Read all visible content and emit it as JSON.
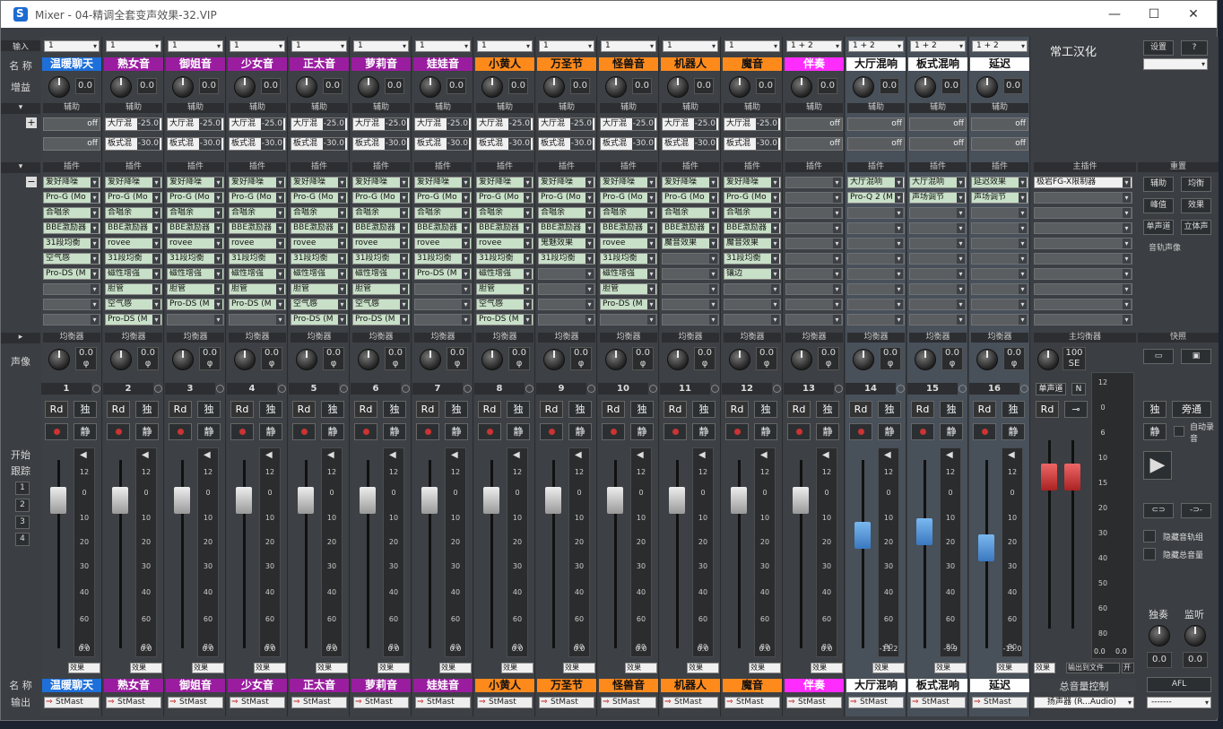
{
  "window": {
    "title": "Mixer - 04-精调全套变声效果-32.VIP",
    "min": "—",
    "max": "☐",
    "close": "✕"
  },
  "row_labels": {
    "input": "输入",
    "name": "名 称",
    "gain": "增益",
    "aux": "辅助",
    "plugin": "插件",
    "eq": "均衡器",
    "pan": "声像",
    "start": "开始",
    "follow": "跟踪",
    "name2": "名 称",
    "output": "输出",
    "groups": [
      "1",
      "2",
      "3",
      "4"
    ]
  },
  "channels": [
    {
      "num": "1",
      "input": "1",
      "name": "温暖聊天",
      "name_bg": "#1e6fd9",
      "name_fg": "#ffffff",
      "gain": "0.0",
      "aux1": "off",
      "aux2": "off",
      "aux_on": false,
      "plugins": [
        "爱好降噪",
        "Pro-G (Mo",
        "合唱余",
        "BBE激励器",
        "31段均衡",
        "空气感",
        "Pro-DS (M",
        "",
        "",
        ""
      ],
      "pan": "0.0",
      "level": "0.0",
      "bus": false
    },
    {
      "num": "2",
      "input": "1",
      "name": "熟女音",
      "name_bg": "#9a1da0",
      "name_fg": "#ffffff",
      "gain": "0.0",
      "aux1": "-25.0",
      "aux2": "-30.0",
      "aux_on": true,
      "plugins": [
        "爱好降噪",
        "Pro-G (Mo",
        "合唱余",
        "BBE激励器",
        "rovee",
        "31段均衡",
        "磁性增强",
        "胆管",
        "空气感",
        "Pro-DS (M"
      ],
      "pan": "0.0",
      "level": "0.0",
      "bus": false
    },
    {
      "num": "3",
      "input": "1",
      "name": "御姐音",
      "name_bg": "#9a1da0",
      "name_fg": "#ffffff",
      "gain": "0.0",
      "aux1": "-25.0",
      "aux2": "-30.0",
      "aux_on": true,
      "plugins": [
        "爱好降噪",
        "Pro-G (Mo",
        "合唱余",
        "BBE激励器",
        "rovee",
        "31段均衡",
        "磁性增强",
        "胆管",
        "Pro-DS (M",
        ""
      ],
      "pan": "0.0",
      "level": "0.0",
      "bus": false
    },
    {
      "num": "4",
      "input": "1",
      "name": "少女音",
      "name_bg": "#9a1da0",
      "name_fg": "#ffffff",
      "gain": "0.0",
      "aux1": "-25.0",
      "aux2": "-30.0",
      "aux_on": true,
      "plugins": [
        "爱好降噪",
        "Pro-G (Mo",
        "合唱余",
        "BBE激励器",
        "rovee",
        "31段均衡",
        "磁性增强",
        "胆管",
        "Pro-DS (M",
        ""
      ],
      "pan": "0.0",
      "level": "0.0",
      "bus": false
    },
    {
      "num": "5",
      "input": "1",
      "name": "正太音",
      "name_bg": "#9a1da0",
      "name_fg": "#ffffff",
      "gain": "0.0",
      "aux1": "-25.0",
      "aux2": "-30.0",
      "aux_on": true,
      "plugins": [
        "爱好降噪",
        "Pro-G (Mo",
        "合唱余",
        "BBE激励器",
        "rovee",
        "31段均衡",
        "磁性增强",
        "胆管",
        "空气感",
        "Pro-DS (M"
      ],
      "pan": "0.0",
      "level": "0.0",
      "bus": false
    },
    {
      "num": "6",
      "input": "1",
      "name": "萝莉音",
      "name_bg": "#9a1da0",
      "name_fg": "#ffffff",
      "gain": "0.0",
      "aux1": "-25.0",
      "aux2": "-30.0",
      "aux_on": true,
      "plugins": [
        "爱好降噪",
        "Pro-G (Mo",
        "合唱余",
        "BBE激励器",
        "rovee",
        "31段均衡",
        "磁性增强",
        "胆管",
        "空气感",
        "Pro-DS (M"
      ],
      "pan": "0.0",
      "level": "0.0",
      "bus": false
    },
    {
      "num": "7",
      "input": "1",
      "name": "娃娃音",
      "name_bg": "#9a1da0",
      "name_fg": "#ffffff",
      "gain": "0.0",
      "aux1": "-25.0",
      "aux2": "-30.0",
      "aux_on": true,
      "plugins": [
        "爱好降噪",
        "Pro-G (Mo",
        "合唱余",
        "BBE激励器",
        "rovee",
        "31段均衡",
        "Pro-DS (M",
        "",
        "",
        ""
      ],
      "pan": "0.0",
      "level": "0.0",
      "bus": false
    },
    {
      "num": "8",
      "input": "1",
      "name": "小黄人",
      "name_bg": "#ff8a1c",
      "name_fg": "#111111",
      "gain": "0.0",
      "aux1": "-25.0",
      "aux2": "-30.0",
      "aux_on": true,
      "plugins": [
        "爱好降噪",
        "Pro-G (Mo",
        "合唱余",
        "BBE激励器",
        "rovee",
        "31段均衡",
        "磁性增强",
        "胆管",
        "空气感",
        "Pro-DS (M"
      ],
      "pan": "0.0",
      "level": "0.0",
      "bus": false
    },
    {
      "num": "9",
      "input": "1",
      "name": "万圣节",
      "name_bg": "#ff8a1c",
      "name_fg": "#111111",
      "gain": "0.0",
      "aux1": "-25.0",
      "aux2": "-30.0",
      "aux_on": true,
      "plugins": [
        "爱好降噪",
        "Pro-G (Mo",
        "合唱余",
        "BBE激励器",
        "鬼魅效果",
        "31段均衡",
        "",
        "",
        "",
        ""
      ],
      "pan": "0.0",
      "level": "0.0",
      "bus": false
    },
    {
      "num": "10",
      "input": "1",
      "name": "怪兽音",
      "name_bg": "#ff8a1c",
      "name_fg": "#111111",
      "gain": "0.0",
      "aux1": "-25.0",
      "aux2": "-30.0",
      "aux_on": true,
      "plugins": [
        "爱好降噪",
        "Pro-G (Mo",
        "合唱余",
        "BBE激励器",
        "rovee",
        "31段均衡",
        "磁性增强",
        "胆管",
        "Pro-DS (M",
        ""
      ],
      "pan": "0.0",
      "level": "0.0",
      "bus": false
    },
    {
      "num": "11",
      "input": "1",
      "name": "机器人",
      "name_bg": "#ff8a1c",
      "name_fg": "#111111",
      "gain": "0.0",
      "aux1": "-25.0",
      "aux2": "-30.0",
      "aux_on": true,
      "plugins": [
        "爱好降噪",
        "Pro-G (Mo",
        "合唱余",
        "BBE激励器",
        "魔音效果",
        "",
        "",
        "",
        "",
        ""
      ],
      "pan": "0.0",
      "level": "0.0",
      "bus": false
    },
    {
      "num": "12",
      "input": "1",
      "name": "魔音",
      "name_bg": "#ff8a1c",
      "name_fg": "#111111",
      "gain": "0.0",
      "aux1": "-25.0",
      "aux2": "-30.0",
      "aux_on": true,
      "plugins": [
        "爱好降噪",
        "Pro-G (Mo",
        "合唱余",
        "BBE激励器",
        "魔音效果",
        "31段均衡",
        "镶边",
        "",
        "",
        ""
      ],
      "pan": "0.0",
      "level": "0.0",
      "bus": false
    },
    {
      "num": "13",
      "input": "1 + 2",
      "name": "伴奏",
      "name_bg": "#ff2cff",
      "name_fg": "#ffffff",
      "gain": "0.0",
      "aux1": "off",
      "aux2": "off",
      "aux_on": false,
      "plugins": [
        "",
        "",
        "",
        "",
        "",
        "",
        "",
        "",
        "",
        ""
      ],
      "pan": "0.0",
      "level": "0.0",
      "bus": false
    },
    {
      "num": "14",
      "input": "1 + 2",
      "name": "大厅混响",
      "name_bg": "#ffffff",
      "name_fg": "#111111",
      "gain": "0.0",
      "aux1": "off",
      "aux2": "off",
      "aux_on": false,
      "plugins": [
        "大厅混响",
        "Pro-Q 2 (M",
        "",
        "",
        "",
        "",
        "",
        "",
        "",
        ""
      ],
      "pan": "0.0",
      "level": "-11.2",
      "bus": true
    },
    {
      "num": "15",
      "input": "1 + 2",
      "name": "板式混响",
      "name_bg": "#ffffff",
      "name_fg": "#111111",
      "gain": "0.0",
      "aux1": "off",
      "aux2": "off",
      "aux_on": false,
      "plugins": [
        "大厅混响",
        "声场调节",
        "",
        "",
        "",
        "",
        "",
        "",
        "",
        ""
      ],
      "pan": "0.0",
      "level": "-9.9",
      "bus": true
    },
    {
      "num": "16",
      "input": "1 + 2",
      "name": "延迟",
      "name_bg": "#ffffff",
      "name_fg": "#111111",
      "gain": "0.0",
      "aux1": "off",
      "aux2": "off",
      "aux_on": false,
      "plugins": [
        "延迟效果",
        "声场调节",
        "",
        "",
        "",
        "",
        "",
        "",
        "",
        ""
      ],
      "pan": "0.0",
      "level": "-15.0",
      "bus": true
    }
  ],
  "channel_labels": {
    "aux_hdr": "辅助",
    "plugin_hdr": "插件",
    "eq_hdr": "均衡器",
    "rd": "Rd",
    "solo": "独",
    "mute": "静",
    "fx": "效果",
    "output": "StMast",
    "aux1_name": "大厅混",
    "aux2_name": "板式混"
  },
  "meter_scale": [
    "12",
    "0",
    "10",
    "20",
    "30",
    "40",
    "60",
    "80"
  ],
  "master": {
    "brand": "常工汉化",
    "plugin_hdr": "主插件",
    "plugin1": "极岩FG-X限制器",
    "eq_hdr": "主均衡器",
    "pan": "100",
    "pan_unit": "SE",
    "mono": "单声道",
    "n": "N",
    "fx": "效果",
    "export": "输出到文件",
    "open": "开",
    "name": "总音量控制",
    "output": "扬声器 (R...Audio)",
    "scale": [
      "12",
      "0",
      "6",
      "10",
      "15",
      "20",
      "30",
      "40",
      "50",
      "60",
      "80"
    ],
    "val_l": "0.0",
    "val_r": "0.0"
  },
  "right_panel": {
    "settings": "设置",
    "help": "?",
    "restore": "重置",
    "aux": "辅助",
    "eq": "均衡",
    "peak": "峰值",
    "fx": "效果",
    "mono": "单声道",
    "stereo": "立体声",
    "track_pan": "音轨声像",
    "snapshot": "快照",
    "solo": "独",
    "bypass": "旁通",
    "mute": "静",
    "auto_rec": "自动录音",
    "hide_tracks": "隐藏音轨组",
    "hide_master": "隐藏总音量",
    "solo_label": "独奏",
    "monitor_label": "监听",
    "solo_val": "0.0",
    "monitor_val": "0.0",
    "afl": "AFL",
    "out_sel": "-------"
  }
}
